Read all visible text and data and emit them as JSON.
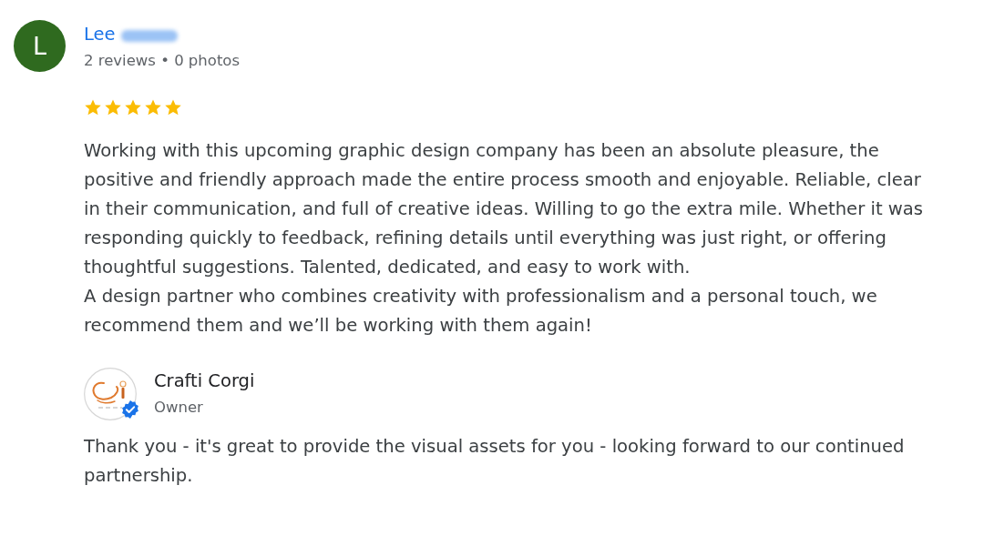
{
  "review": {
    "author": {
      "initial": "L",
      "name": "Lee",
      "surname_blurred": true,
      "stats": "2 reviews • 0 photos"
    },
    "stars": 5,
    "text": "Working with this upcoming graphic design company has been an absolute pleasure, the positive and friendly approach made the entire process smooth and enjoyable. Reliable, clear in their communication, and full of creative ideas. Willing to go the extra mile. Whether it was responding quickly to feedback, refining details until everything was just right, or offering thoughtful suggestions. Talented, dedicated, and easy to work with.\nA design partner who combines creativity with professionalism and a personal touch, we recommend them and we’ll be working with them again!"
  },
  "owner_reply": {
    "name": "Crafti Corgi",
    "role": "Owner",
    "verified": true,
    "text": "Thank you - it's great to provide the visual assets for you - looking forward to our continued partnership."
  }
}
